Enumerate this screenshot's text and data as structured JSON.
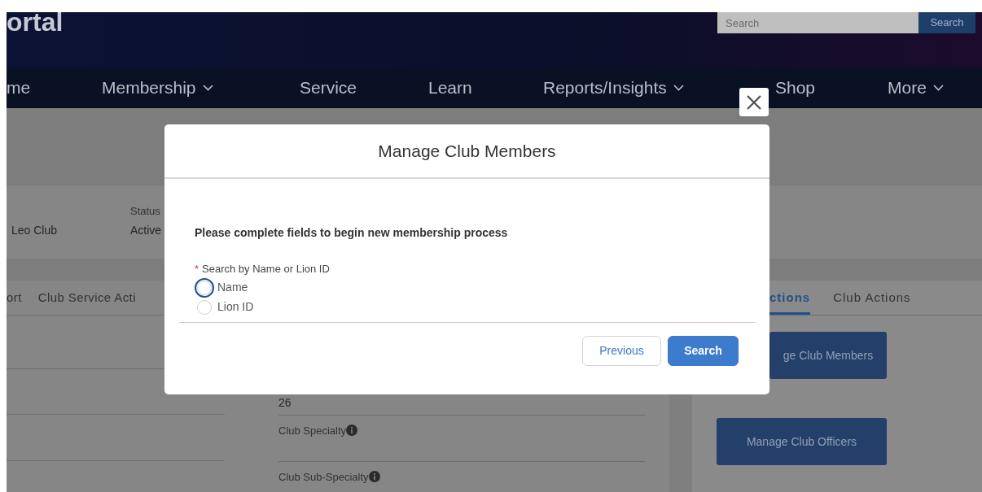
{
  "header": {
    "logo_text": "ortal",
    "search": {
      "placeholder": "Search",
      "button": "Search"
    }
  },
  "nav": [
    {
      "label": "me",
      "dropdown": false
    },
    {
      "label": "Membership",
      "dropdown": true
    },
    {
      "label": "Service",
      "dropdown": false
    },
    {
      "label": "Learn",
      "dropdown": false
    },
    {
      "label": "Reports/Insights",
      "dropdown": true
    },
    {
      "label": "Shop",
      "dropdown": false
    },
    {
      "label": "More",
      "dropdown": true
    }
  ],
  "club": {
    "name": "Leo Club",
    "status_label": "Status",
    "status": "Active"
  },
  "tabs_left": [
    {
      "label": "ort",
      "selected": false
    },
    {
      "label": "Club Service Acti",
      "selected": false
    }
  ],
  "tabs_right": [
    {
      "label": "ctions",
      "selected": true
    },
    {
      "label": "Club Actions",
      "selected": false
    }
  ],
  "details": [
    {
      "text": "26",
      "kind": "value",
      "info": false
    },
    {
      "text": "Club Specialty",
      "kind": "label",
      "info": true
    },
    {
      "text": "Club Sub-Specialty",
      "kind": "label",
      "info": true
    }
  ],
  "actions": [
    "ge Club Members",
    "Manage Club Officers"
  ],
  "modal": {
    "title": "Manage Club Members",
    "instruction": "Please complete fields to begin new membership process",
    "field_label": "Search by Name or Lion ID",
    "required_marker": "*",
    "options": [
      {
        "label": "Name",
        "selected": false,
        "focused": true
      },
      {
        "label": "Lion ID",
        "selected": false,
        "focused": false
      }
    ],
    "buttons": [
      {
        "label": "Previous",
        "kind": "neutral"
      },
      {
        "label": "Search",
        "kind": "brand"
      }
    ]
  }
}
